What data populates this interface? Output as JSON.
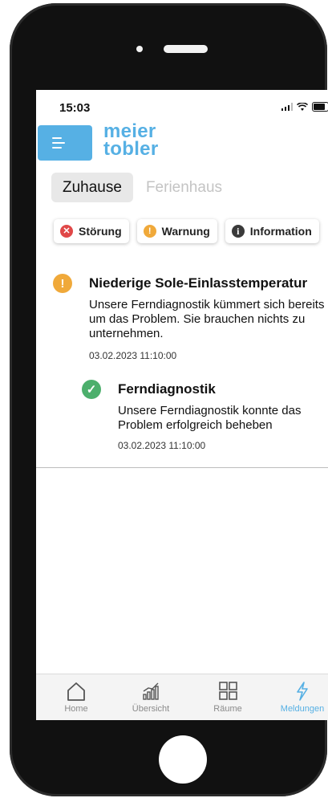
{
  "status_bar": {
    "time": "15:03"
  },
  "brand": {
    "logo_line1": "meier",
    "logo_line2": "tobler"
  },
  "tabs": [
    {
      "label": "Zuhause",
      "active": true
    },
    {
      "label": "Ferienhaus",
      "active": false
    }
  ],
  "filters": [
    {
      "label": "Störung",
      "icon": "error-x-icon",
      "icon_glyph": "✕",
      "color": "#e04848"
    },
    {
      "label": "Warnung",
      "icon": "warning-exclamation-icon",
      "icon_glyph": "!",
      "color": "#f0a93a"
    },
    {
      "label": "Information",
      "icon": "info-icon",
      "icon_glyph": "i",
      "color": "#3a3a3a"
    }
  ],
  "messages": [
    {
      "icon": "warning-exclamation-icon",
      "icon_glyph": "!",
      "color": "#f0a93a",
      "title": "Niederige Sole-Einlasstemperatur",
      "body": "Unsere Ferndiagnostik kümmert sich bereits um das Problem. Sie brauchen nichts zu unternehmen.",
      "date": "03.02.2023 11:10:00"
    },
    {
      "icon": "check-circle-icon",
      "icon_glyph": "✓",
      "color": "#4caf6c",
      "title": "Ferndiagnostik",
      "body": "Unsere Ferndiagnostik konnte das Problem erfolgreich beheben",
      "date": "03.02.2023 11:10:00"
    }
  ],
  "bottom_nav": [
    {
      "label": "Home",
      "icon": "home-icon",
      "active": false
    },
    {
      "label": "Übersicht",
      "icon": "chart-icon",
      "active": false
    },
    {
      "label": "Räume",
      "icon": "grid-icon",
      "active": false
    },
    {
      "label": "Meldungen",
      "icon": "lightning-icon",
      "active": true
    }
  ],
  "colors": {
    "accent": "#56b0e4",
    "warning": "#f0a93a",
    "error": "#e04848",
    "success": "#4caf6c"
  }
}
